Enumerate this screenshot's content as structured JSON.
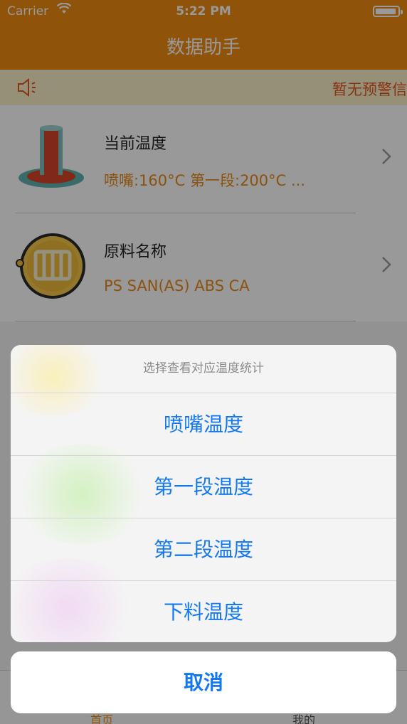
{
  "status_bar": {
    "carrier": "Carrier",
    "time": "5:22 PM"
  },
  "nav": {
    "title": "数据助手"
  },
  "notice": {
    "icon": "speaker-icon",
    "text": "暂无预警信"
  },
  "list": [
    {
      "icon": "thermometer-icon",
      "title": "当前温度",
      "subtitle": "喷嘴:160°C  第一段:200°C ..."
    },
    {
      "icon": "material-gauge-icon",
      "title": "原料名称",
      "subtitle": "PS SAN(AS) ABS CA"
    }
  ],
  "action_sheet": {
    "title": "选择查看对应温度统计",
    "options": [
      "喷嘴温度",
      "第一段温度",
      "第二段温度",
      "下料温度"
    ],
    "cancel": "取消"
  },
  "tabbar": {
    "home": "首页",
    "mine": "我的"
  },
  "colors": {
    "brand": "#ee8a12",
    "accent_blue": "#1479f0",
    "subtitle_orange": "#ea8a18"
  }
}
